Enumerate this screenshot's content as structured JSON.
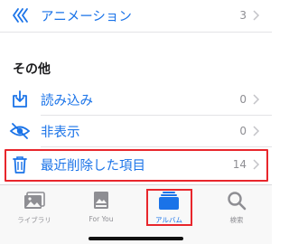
{
  "rows": [
    {
      "label": "アニメーション",
      "count": "3",
      "icon": "animation-icon"
    },
    {
      "label": "読み込み",
      "count": "0",
      "icon": "import-icon"
    },
    {
      "label": "非表示",
      "count": "0",
      "icon": "hidden-eye-icon"
    },
    {
      "label": "最近削除した項目",
      "count": "14",
      "icon": "trash-icon"
    }
  ],
  "section": {
    "title": "その他"
  },
  "tabs": [
    {
      "label": "ライブラリ",
      "icon": "photo-library-icon",
      "active": false
    },
    {
      "label": "For You",
      "icon": "for-you-icon",
      "active": false
    },
    {
      "label": "アルバム",
      "icon": "album-icon",
      "active": true
    },
    {
      "label": "検索",
      "icon": "search-icon",
      "active": false
    }
  ],
  "colors": {
    "accent": "#1a73e8",
    "highlight": "#e8262c",
    "muted": "#8e8e93"
  }
}
